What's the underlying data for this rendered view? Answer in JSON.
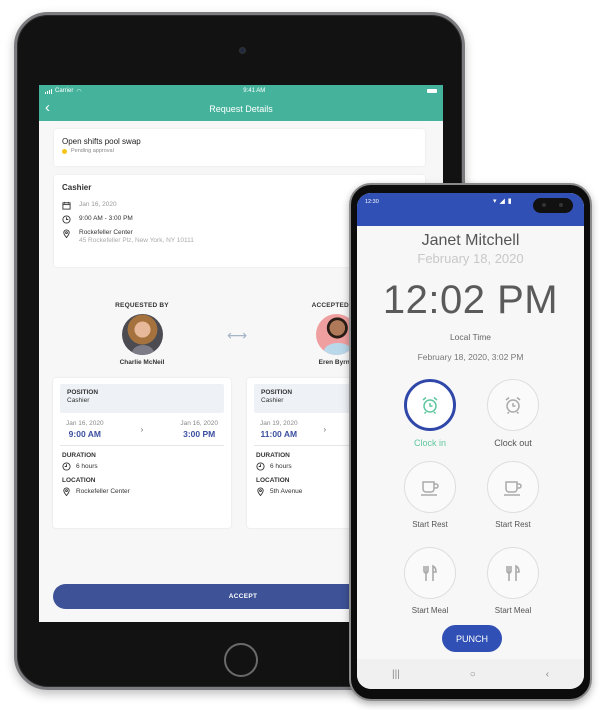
{
  "tablet": {
    "status_bar": {
      "carrier": "Carrier",
      "time": "9:41 AM"
    },
    "nav": {
      "title": "Request Details",
      "back_icon": "chevron-left-icon"
    },
    "swap_card": {
      "title": "Open shifts pool swap",
      "status": "Pending approval",
      "status_color": "#f5c518"
    },
    "shift_card": {
      "title": "Cashier",
      "date": "Jan 16, 2020",
      "time_range": "9:00 AM - 3:00 PM",
      "location_name": "Rockefeller Center",
      "location_address": "45 Rockefeller Plz, New York, NY 10111"
    },
    "requested_by": {
      "label": "REQUESTED BY",
      "name": "Charlie McNeil"
    },
    "accepted_by": {
      "label": "ACCEPTED BY",
      "name": "Eren Byrne"
    },
    "requester_details": {
      "position_label": "POSITION",
      "position": "Cashier",
      "start_date": "Jan 16, 2020",
      "start_time": "9:00 AM",
      "end_date": "Jan 16, 2020",
      "end_time": "3:00 PM",
      "duration_label": "DURATION",
      "duration": "6 hours",
      "location_label": "LOCATION",
      "location": "Rockefeller Center"
    },
    "accepter_details": {
      "position_label": "POSITION",
      "position": "Cashier",
      "start_date": "Jan 19, 2020",
      "start_time": "11:00 AM",
      "duration_label": "DURATION",
      "duration": "6 hours",
      "location_label": "LOCATION",
      "location": "5th Avenue"
    },
    "accept_label": "ACCEPT",
    "accent_color": "#45b39c",
    "button_color": "#3d5297"
  },
  "phone": {
    "status_time": "12:30",
    "employee_name": "Janet Mitchell",
    "date": "February 18, 2020",
    "clock": "12:02 PM",
    "local_time_label": "Local Time",
    "local_datetime": "February 18, 2020, 3:02 PM",
    "actions": [
      {
        "label": "Clock in",
        "icon": "alarm-clock-icon",
        "selected": true
      },
      {
        "label": "Clock out",
        "icon": "alarm-clock-icon",
        "selected": false
      },
      {
        "label": "Start Rest",
        "icon": "coffee-cup-icon",
        "selected": false
      },
      {
        "label": "Start Rest",
        "icon": "coffee-cup-icon",
        "selected": false
      },
      {
        "label": "Start Meal",
        "icon": "fork-knife-icon",
        "selected": false
      },
      {
        "label": "Start Meal",
        "icon": "fork-knife-icon",
        "selected": false
      }
    ],
    "punch_label": "PUNCH",
    "accent_color": "#3050b5",
    "nav_bar": {
      "recents": "|||",
      "home": "○",
      "back": "‹"
    }
  }
}
